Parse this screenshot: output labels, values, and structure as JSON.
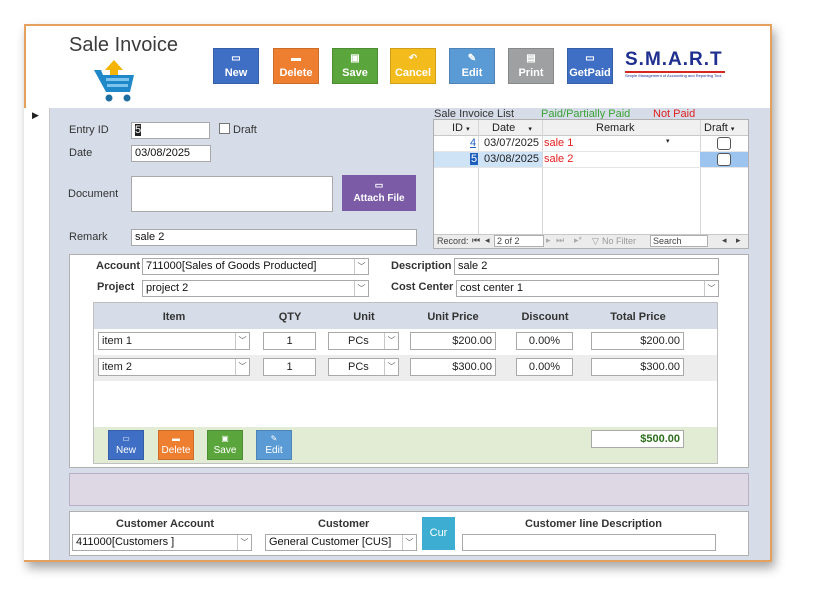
{
  "header": {
    "title": "Sale Invoice",
    "cart_icon": "shopping-cart-upload-icon"
  },
  "toolbar": {
    "buttons": [
      {
        "label": "New",
        "icon": "new-document-icon",
        "color": "#3f6fc5"
      },
      {
        "label": "Delete",
        "icon": "delete-icon",
        "color": "#ef7f30"
      },
      {
        "label": "Save",
        "icon": "save-icon",
        "color": "#5aa63c"
      },
      {
        "label": "Cancel",
        "icon": "undo-icon",
        "color": "#f4bb1c"
      },
      {
        "label": "Edit",
        "icon": "edit-icon",
        "color": "#5b9bd5"
      },
      {
        "label": "Print",
        "icon": "print-icon",
        "color": "#9ea0a2"
      },
      {
        "label": "GetPaid",
        "icon": "cash-icon",
        "color": "#3f6fc5"
      }
    ]
  },
  "logo": {
    "text": "S.M.A.R.T",
    "tagline": "Simple Management of Accounting and Reporting Tool"
  },
  "form": {
    "entry_id_label": "Entry ID",
    "entry_id_value": "5",
    "draft_label": "Draft",
    "date_label": "Date",
    "date_value": "03/08/2025",
    "document_label": "Document",
    "attach_label": "Attach File",
    "remark_label": "Remark",
    "remark_value": "sale 2"
  },
  "invoice_list": {
    "title": "Sale Invoice List",
    "legend_paid": "Paid/Partially Paid",
    "legend_not_paid": "Not Paid",
    "paid_color": "#3aa335",
    "not_paid_color": "#e0201f",
    "columns": [
      "ID",
      "Date",
      "Remark",
      "Draft"
    ],
    "rows": [
      {
        "id": "4",
        "date": "03/07/2025",
        "remark": "sale 1"
      },
      {
        "id": "5",
        "date": "03/08/2025",
        "remark": "sale 2"
      }
    ],
    "nav": {
      "record_label": "Record:",
      "position": "2 of 2",
      "no_filter": "No Filter",
      "search": "Search"
    }
  },
  "details": {
    "account_label": "Account",
    "account_value": "711000[Sales of Goods Producted]",
    "description_label": "Description",
    "description_value": "sale 2",
    "project_label": "Project",
    "project_value": "project 2",
    "cost_center_label": "Cost Center",
    "cost_center_value": "cost center 1",
    "columns": [
      "Item",
      "QTY",
      "Unit",
      "Unit Price",
      "Discount",
      "Total Price"
    ],
    "lines": [
      {
        "item": "item 1",
        "qty": "1",
        "unit": "PCs",
        "price": "$200.00",
        "discount": "0.00%",
        "total": "$200.00"
      },
      {
        "item": "item 2",
        "qty": "1",
        "unit": "PCs",
        "price": "$300.00",
        "discount": "0.00%",
        "total": "$300.00"
      }
    ],
    "grand_total": "$500.00",
    "buttons": [
      {
        "label": "New",
        "color": "#3f6fc5"
      },
      {
        "label": "Delete",
        "color": "#ef7f30"
      },
      {
        "label": "Save",
        "color": "#5aa63c"
      },
      {
        "label": "Edit",
        "color": "#5b9bd5"
      }
    ]
  },
  "customer": {
    "account_label": "Customer Account",
    "account_value": "411000[Customers ]",
    "customer_label": "Customer",
    "customer_value": "General Customer [CUS]",
    "cur_label": "Cur",
    "line_desc_label": "Customer line Description",
    "line_desc_value": ""
  }
}
